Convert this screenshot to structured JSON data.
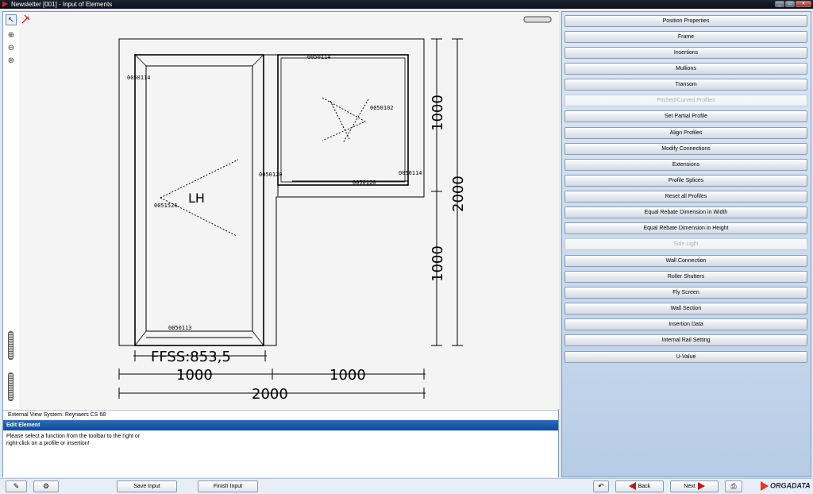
{
  "window": {
    "title": "Newsletter [001] - Input of Elements"
  },
  "toolbar": {
    "tools": [
      {
        "name": "select-tool",
        "glyph": "↖"
      },
      {
        "name": "zoom-in-tool",
        "glyph": "⊕"
      },
      {
        "name": "zoom-out-tool",
        "glyph": "⊖"
      },
      {
        "name": "zoom-fit-tool",
        "glyph": "⊛"
      }
    ]
  },
  "drawing": {
    "profile_codes": {
      "outer_left_top": "0050114",
      "transom_top": "0050114",
      "glass_right": "0050102",
      "mullion": "0050120",
      "transom_bottom": "0050120",
      "right_frame": "0050114",
      "sash": "0051526",
      "threshold": "0050113"
    },
    "opening": "LH",
    "ffss": "FFSS:853,5",
    "dims": {
      "width_left": "1000",
      "width_right": "1000",
      "width_total": "2000",
      "height_top": "1000",
      "height_bottom": "1000",
      "height_total": "2000"
    }
  },
  "status": {
    "text": "External View   System: Reynaers CS 68"
  },
  "edit_element": {
    "title": "Edit Element",
    "message_line1": "Please select a function from the toolbar to the right or",
    "message_line2": "right-click on a profile or insertion!"
  },
  "functions": [
    {
      "label": "Position Properties",
      "enabled": true
    },
    {
      "label": "Frame",
      "enabled": true
    },
    {
      "label": "Insertions",
      "enabled": true
    },
    {
      "label": "Mullions",
      "enabled": true
    },
    {
      "label": "Transom",
      "enabled": true
    },
    {
      "label": "Pitched/Curved Profiles",
      "enabled": false
    },
    {
      "label": "Set Partial Profile",
      "enabled": true
    },
    {
      "label": "Align Profiles",
      "enabled": true
    },
    {
      "label": "Modify Connections",
      "enabled": true
    },
    {
      "label": "Extensions",
      "enabled": true
    },
    {
      "label": "Profile Splices",
      "enabled": true
    },
    {
      "label": "Reset all Profiles",
      "enabled": true
    },
    {
      "label": "Equal Rebate Dimension in Width",
      "enabled": true
    },
    {
      "label": "Equal Rebate Dimension in Height",
      "enabled": true
    },
    {
      "label": "Side Light",
      "enabled": false
    },
    {
      "label": "Wall Connection",
      "enabled": true
    },
    {
      "label": "Roller Shutters",
      "enabled": true
    },
    {
      "label": "Fly Screen",
      "enabled": true
    },
    {
      "label": "Wall Section",
      "enabled": true
    },
    {
      "label": "Insertion Data",
      "enabled": true
    },
    {
      "label": "Internal Rail Setting",
      "enabled": true
    },
    {
      "label": "U-Value",
      "enabled": true
    }
  ],
  "footer": {
    "save_label": "Save Input",
    "finish_label": "Finish Input",
    "back_label": "Back",
    "next_label": "Next",
    "brand": "ORGADATA"
  }
}
